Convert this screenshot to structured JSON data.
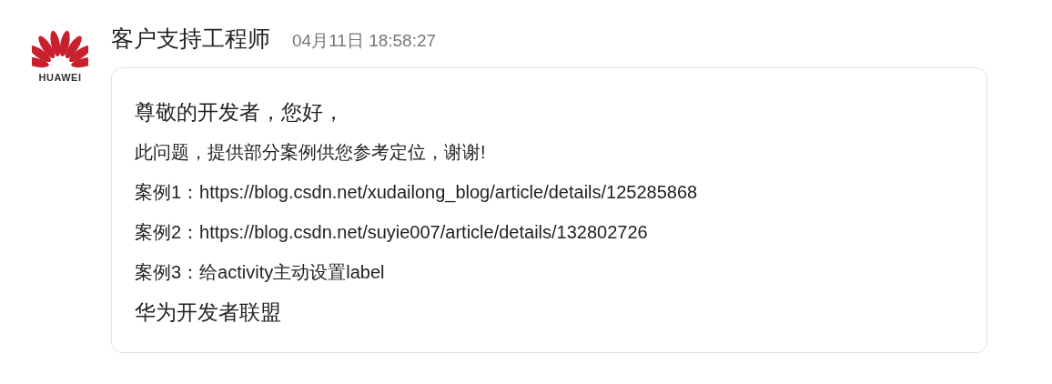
{
  "avatar": {
    "logo_text": "HUAWEI"
  },
  "sender": {
    "name": "客户支持工程师",
    "time": "04月11日 18:58:27"
  },
  "message": {
    "lines": [
      {
        "kind": "large",
        "text": "尊敬的开发者，您好，"
      },
      {
        "kind": "normal",
        "text": "此问题，提供部分案例供您参考定位，谢谢!"
      },
      {
        "kind": "normal",
        "text": "案例1：https://blog.csdn.net/xudailong_blog/article/details/125285868"
      },
      {
        "kind": "normal",
        "text": "案例2：https://blog.csdn.net/suyie007/article/details/132802726"
      },
      {
        "kind": "normal",
        "text": "案例3：给activity主动设置label"
      },
      {
        "kind": "large",
        "text": "华为开发者联盟"
      }
    ]
  }
}
